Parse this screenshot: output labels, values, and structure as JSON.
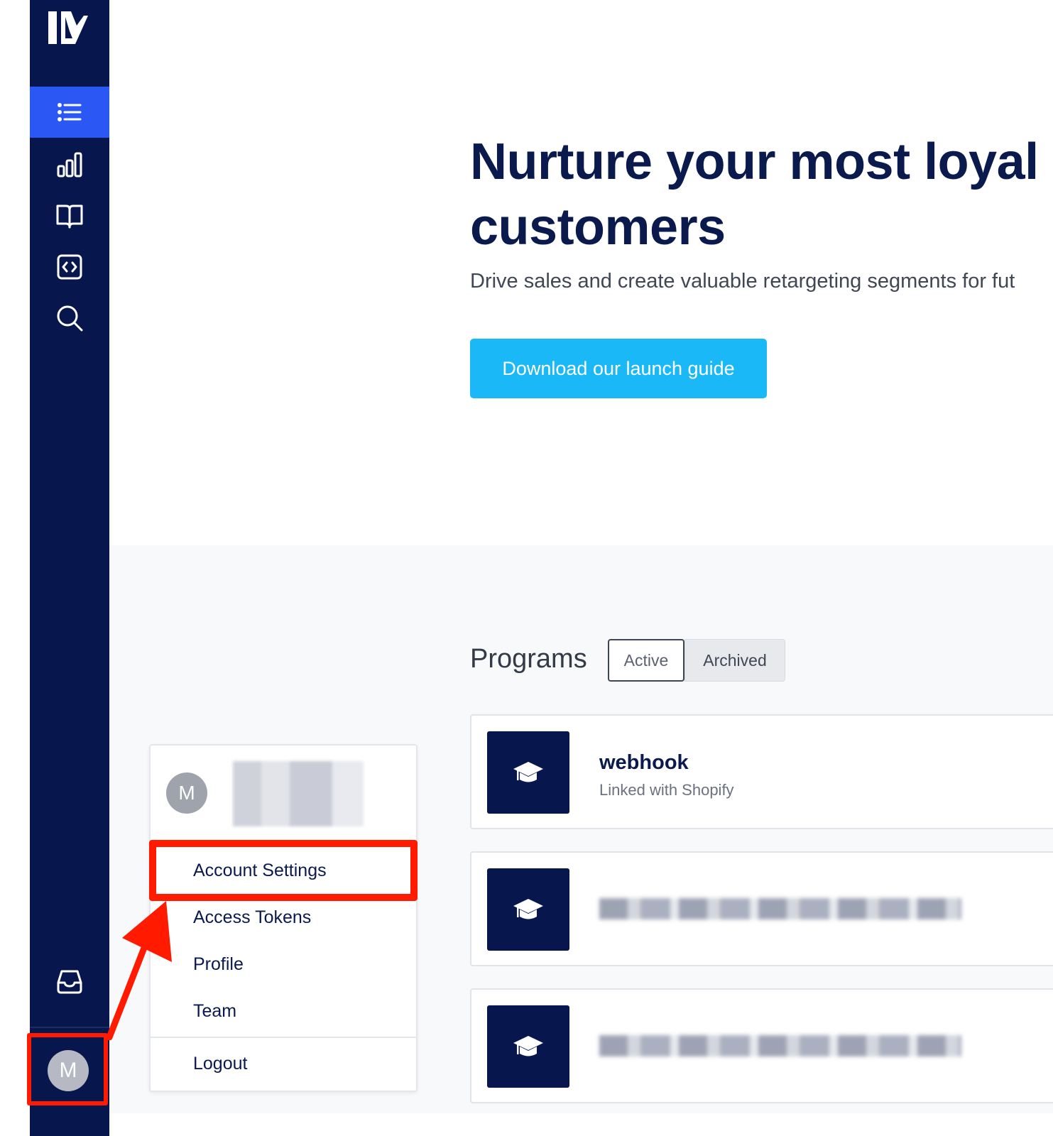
{
  "sidebar": {
    "logo_icon": "brand-logo-icon",
    "items": [
      {
        "name": "programs",
        "icon": "list-icon",
        "active": true
      },
      {
        "name": "analytics",
        "icon": "bar-chart-icon"
      },
      {
        "name": "docs",
        "icon": "book-icon"
      },
      {
        "name": "integrations",
        "icon": "code-icon"
      },
      {
        "name": "search",
        "icon": "search-icon"
      }
    ],
    "inbox_icon": "inbox-icon",
    "avatar_initial": "M"
  },
  "hero": {
    "title": "Nurture your most loyal customers",
    "subtitle": "Drive sales and create valuable retargeting segments for fut",
    "cta_label": "Download our launch guide"
  },
  "programs": {
    "title": "Programs",
    "tabs": [
      {
        "label": "Active",
        "selected": true
      },
      {
        "label": "Archived",
        "selected": false
      }
    ],
    "list": [
      {
        "name": "webhook",
        "subtitle": "Linked with Shopify",
        "icon": "graduation-cap-icon"
      },
      {
        "icon": "graduation-cap-icon"
      },
      {
        "icon": "graduation-cap-icon"
      }
    ]
  },
  "user_menu": {
    "avatar_initial": "M",
    "items": {
      "account_settings": "Account Settings",
      "access_tokens": "Access Tokens",
      "profile": "Profile",
      "team": "Team",
      "logout": "Logout"
    }
  },
  "colors": {
    "sidebar": "#07174e",
    "active_nav": "#2b58f5",
    "cta": "#1ab8f7",
    "annotation": "#ff1a00",
    "heading": "#0a1a4d"
  }
}
